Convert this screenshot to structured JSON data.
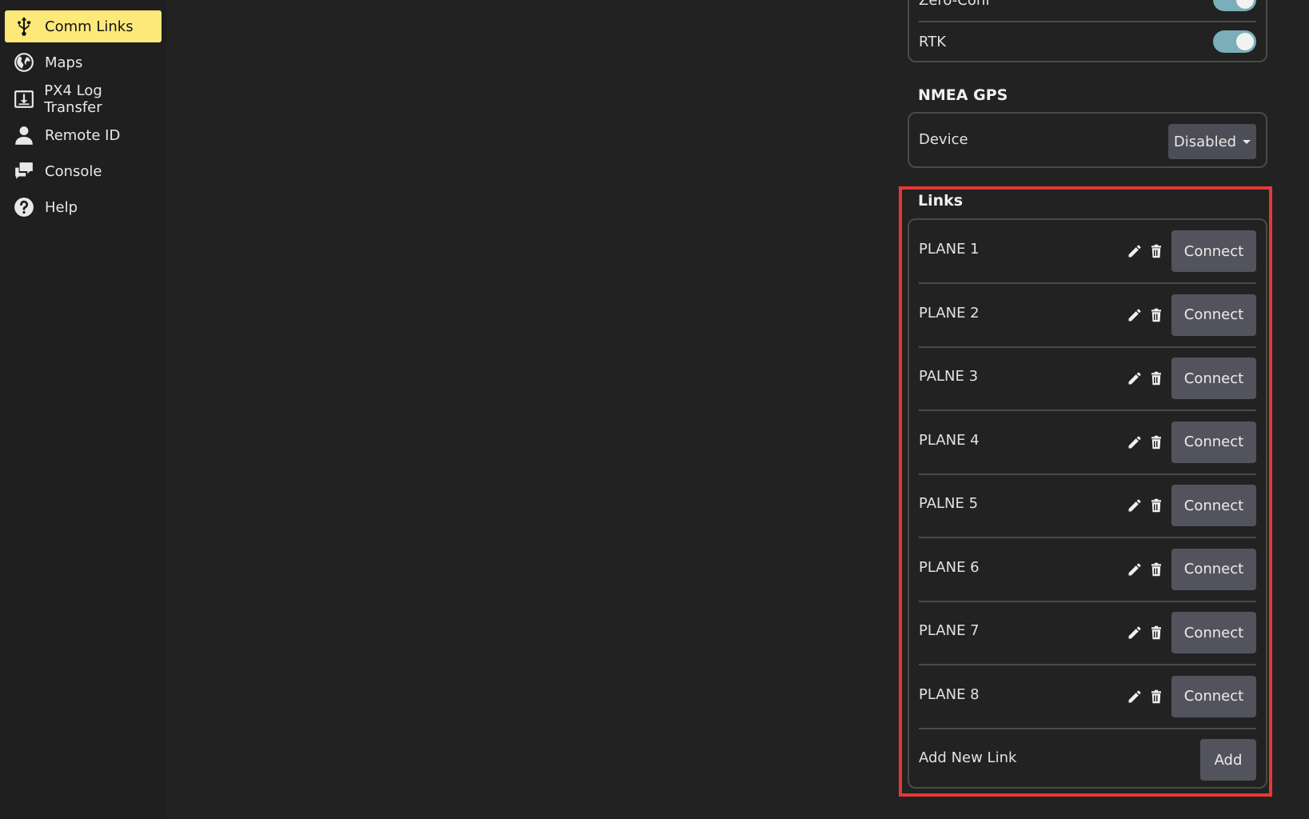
{
  "sidebar": {
    "items": [
      {
        "label": "Comm Links",
        "icon": "usb-icon",
        "active": true
      },
      {
        "label": "Maps",
        "icon": "globe-icon",
        "active": false
      },
      {
        "label": "PX4 Log Transfer",
        "icon": "download-icon",
        "active": false
      },
      {
        "label": "Remote ID",
        "icon": "person-icon",
        "active": false
      },
      {
        "label": "Console",
        "icon": "chat-icon",
        "active": false
      },
      {
        "label": "Help",
        "icon": "help-icon",
        "active": false
      }
    ]
  },
  "autoconnect": {
    "zeroconf_label": "Zero-Conf",
    "rtk_label": "RTK",
    "rtk_enabled": true,
    "zeroconf_enabled": true
  },
  "nmea": {
    "title": "NMEA GPS",
    "device_label": "Device",
    "device_value": "Disabled"
  },
  "links": {
    "title": "Links",
    "connect_label": "Connect",
    "items": [
      "PLANE 1",
      "PLANE 2",
      "PALNE 3",
      "PLANE 4",
      "PALNE 5",
      "PLANE 6",
      "PLANE 7",
      "PLANE 8"
    ],
    "add_label": "Add New Link",
    "add_button": "Add"
  },
  "colors": {
    "active_nav": "#fde97a",
    "toggle_on": "#7aaeb8",
    "button": "#53535d",
    "highlight": "#e53935"
  }
}
